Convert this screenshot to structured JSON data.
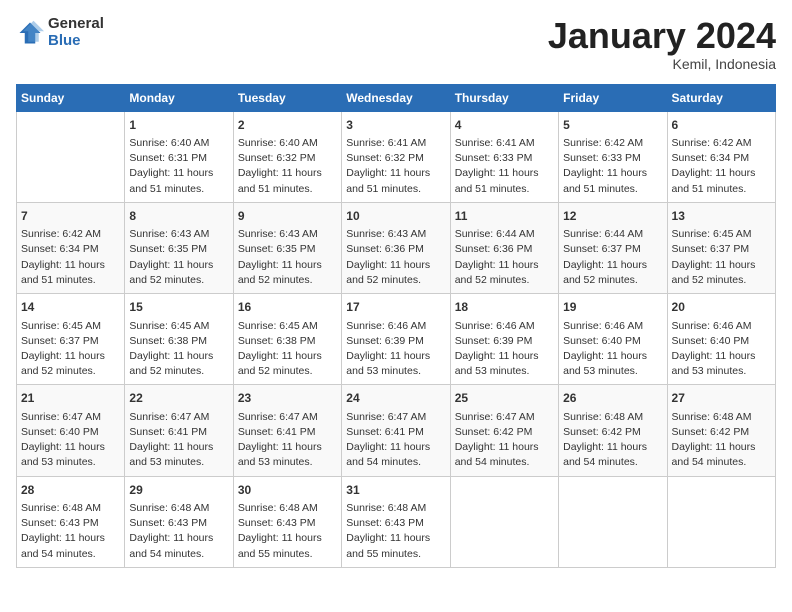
{
  "header": {
    "logo_general": "General",
    "logo_blue": "Blue",
    "month_year": "January 2024",
    "location": "Kemil, Indonesia"
  },
  "days_of_week": [
    "Sunday",
    "Monday",
    "Tuesday",
    "Wednesday",
    "Thursday",
    "Friday",
    "Saturday"
  ],
  "weeks": [
    [
      {
        "day": "",
        "content": ""
      },
      {
        "day": "1",
        "content": "Sunrise: 6:40 AM\nSunset: 6:31 PM\nDaylight: 11 hours\nand 51 minutes."
      },
      {
        "day": "2",
        "content": "Sunrise: 6:40 AM\nSunset: 6:32 PM\nDaylight: 11 hours\nand 51 minutes."
      },
      {
        "day": "3",
        "content": "Sunrise: 6:41 AM\nSunset: 6:32 PM\nDaylight: 11 hours\nand 51 minutes."
      },
      {
        "day": "4",
        "content": "Sunrise: 6:41 AM\nSunset: 6:33 PM\nDaylight: 11 hours\nand 51 minutes."
      },
      {
        "day": "5",
        "content": "Sunrise: 6:42 AM\nSunset: 6:33 PM\nDaylight: 11 hours\nand 51 minutes."
      },
      {
        "day": "6",
        "content": "Sunrise: 6:42 AM\nSunset: 6:34 PM\nDaylight: 11 hours\nand 51 minutes."
      }
    ],
    [
      {
        "day": "7",
        "content": "Sunrise: 6:42 AM\nSunset: 6:34 PM\nDaylight: 11 hours\nand 51 minutes."
      },
      {
        "day": "8",
        "content": "Sunrise: 6:43 AM\nSunset: 6:35 PM\nDaylight: 11 hours\nand 52 minutes."
      },
      {
        "day": "9",
        "content": "Sunrise: 6:43 AM\nSunset: 6:35 PM\nDaylight: 11 hours\nand 52 minutes."
      },
      {
        "day": "10",
        "content": "Sunrise: 6:43 AM\nSunset: 6:36 PM\nDaylight: 11 hours\nand 52 minutes."
      },
      {
        "day": "11",
        "content": "Sunrise: 6:44 AM\nSunset: 6:36 PM\nDaylight: 11 hours\nand 52 minutes."
      },
      {
        "day": "12",
        "content": "Sunrise: 6:44 AM\nSunset: 6:37 PM\nDaylight: 11 hours\nand 52 minutes."
      },
      {
        "day": "13",
        "content": "Sunrise: 6:45 AM\nSunset: 6:37 PM\nDaylight: 11 hours\nand 52 minutes."
      }
    ],
    [
      {
        "day": "14",
        "content": "Sunrise: 6:45 AM\nSunset: 6:37 PM\nDaylight: 11 hours\nand 52 minutes."
      },
      {
        "day": "15",
        "content": "Sunrise: 6:45 AM\nSunset: 6:38 PM\nDaylight: 11 hours\nand 52 minutes."
      },
      {
        "day": "16",
        "content": "Sunrise: 6:45 AM\nSunset: 6:38 PM\nDaylight: 11 hours\nand 52 minutes."
      },
      {
        "day": "17",
        "content": "Sunrise: 6:46 AM\nSunset: 6:39 PM\nDaylight: 11 hours\nand 53 minutes."
      },
      {
        "day": "18",
        "content": "Sunrise: 6:46 AM\nSunset: 6:39 PM\nDaylight: 11 hours\nand 53 minutes."
      },
      {
        "day": "19",
        "content": "Sunrise: 6:46 AM\nSunset: 6:40 PM\nDaylight: 11 hours\nand 53 minutes."
      },
      {
        "day": "20",
        "content": "Sunrise: 6:46 AM\nSunset: 6:40 PM\nDaylight: 11 hours\nand 53 minutes."
      }
    ],
    [
      {
        "day": "21",
        "content": "Sunrise: 6:47 AM\nSunset: 6:40 PM\nDaylight: 11 hours\nand 53 minutes."
      },
      {
        "day": "22",
        "content": "Sunrise: 6:47 AM\nSunset: 6:41 PM\nDaylight: 11 hours\nand 53 minutes."
      },
      {
        "day": "23",
        "content": "Sunrise: 6:47 AM\nSunset: 6:41 PM\nDaylight: 11 hours\nand 53 minutes."
      },
      {
        "day": "24",
        "content": "Sunrise: 6:47 AM\nSunset: 6:41 PM\nDaylight: 11 hours\nand 54 minutes."
      },
      {
        "day": "25",
        "content": "Sunrise: 6:47 AM\nSunset: 6:42 PM\nDaylight: 11 hours\nand 54 minutes."
      },
      {
        "day": "26",
        "content": "Sunrise: 6:48 AM\nSunset: 6:42 PM\nDaylight: 11 hours\nand 54 minutes."
      },
      {
        "day": "27",
        "content": "Sunrise: 6:48 AM\nSunset: 6:42 PM\nDaylight: 11 hours\nand 54 minutes."
      }
    ],
    [
      {
        "day": "28",
        "content": "Sunrise: 6:48 AM\nSunset: 6:43 PM\nDaylight: 11 hours\nand 54 minutes."
      },
      {
        "day": "29",
        "content": "Sunrise: 6:48 AM\nSunset: 6:43 PM\nDaylight: 11 hours\nand 54 minutes."
      },
      {
        "day": "30",
        "content": "Sunrise: 6:48 AM\nSunset: 6:43 PM\nDaylight: 11 hours\nand 55 minutes."
      },
      {
        "day": "31",
        "content": "Sunrise: 6:48 AM\nSunset: 6:43 PM\nDaylight: 11 hours\nand 55 minutes."
      },
      {
        "day": "",
        "content": ""
      },
      {
        "day": "",
        "content": ""
      },
      {
        "day": "",
        "content": ""
      }
    ]
  ]
}
